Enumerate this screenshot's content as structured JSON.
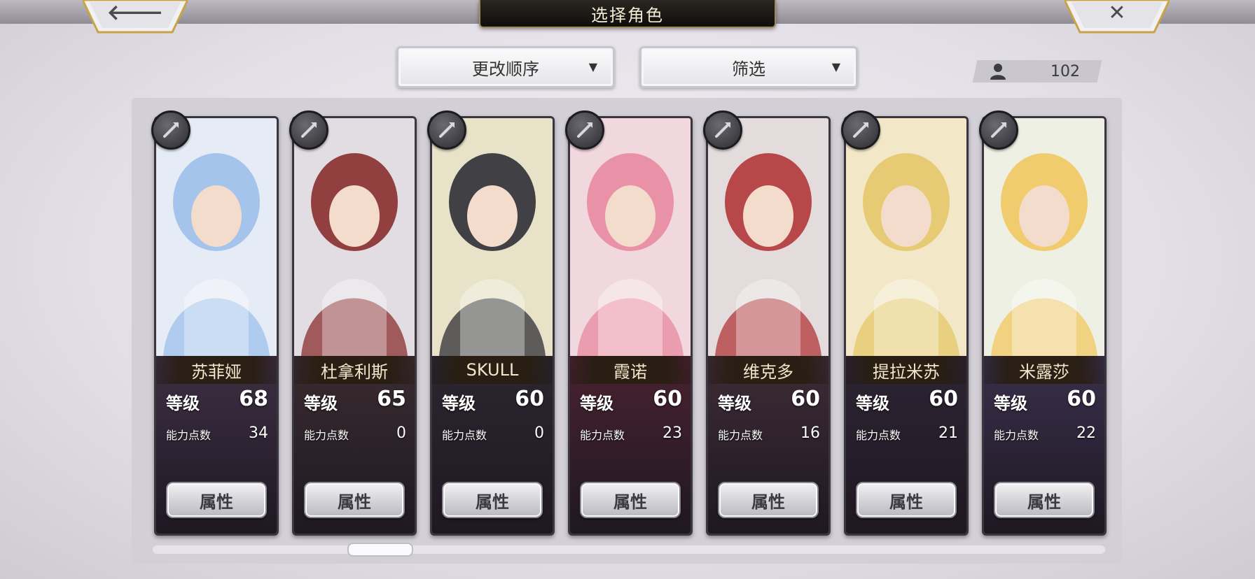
{
  "header": {
    "title": "选择角色"
  },
  "nav": {
    "back_glyph": "🡐",
    "close_glyph": "✕"
  },
  "toolbar": {
    "sort_label": "更改顺序",
    "filter_label": "筛选",
    "arrow_glyph": "▼",
    "unit_count": "102",
    "count_icon": "person-icon"
  },
  "characters": [
    {
      "name": "苏菲娅",
      "level": "68",
      "ability_points": "34",
      "weapon": "axe-icon",
      "bg": "#e6ecf6",
      "accent": "#9cc0ea",
      "lower": "#3e2f44"
    },
    {
      "name": "杜拿利斯",
      "level": "65",
      "ability_points": "0",
      "weapon": "staff-icon",
      "bg": "#e2dde2",
      "accent": "#8a2e2e",
      "lower": "#3a2c30"
    },
    {
      "name": "SKULL",
      "level": "60",
      "ability_points": "0",
      "weapon": "gauntlet-icon",
      "bg": "#e8e2c8",
      "accent": "#2f2f36",
      "lower": "#2c2630"
    },
    {
      "name": "霞诺",
      "level": "60",
      "ability_points": "23",
      "weapon": "sword-icon",
      "bg": "#f1d8de",
      "accent": "#e88aa0",
      "lower": "#4a2230"
    },
    {
      "name": "维克多",
      "level": "60",
      "ability_points": "16",
      "weapon": "blade-icon",
      "bg": "#e4dcdc",
      "accent": "#b2363a",
      "lower": "#3e2c36"
    },
    {
      "name": "提拉米苏",
      "level": "60",
      "ability_points": "21",
      "weapon": "spear-icon",
      "bg": "#f2e8c8",
      "accent": "#e6c86a",
      "lower": "#2e2434"
    },
    {
      "name": "米露莎",
      "level": "60",
      "ability_points": "22",
      "weapon": "spear-icon",
      "bg": "#eef0e4",
      "accent": "#f0c860",
      "lower": "#3a304c"
    }
  ],
  "labels": {
    "level": "等级",
    "ability_points": "能力点数",
    "attributes_button": "属性"
  }
}
